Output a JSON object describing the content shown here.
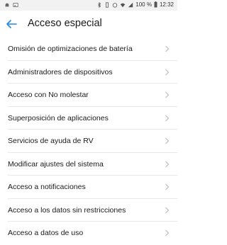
{
  "status_bar": {
    "battery": "100 %",
    "time": "12:32",
    "icons": [
      "android-icon",
      "image-icon",
      "bluetooth-icon",
      "vibrate-icon",
      "alarm-icon",
      "wifi-icon",
      "signal-icon",
      "battery-icon"
    ]
  },
  "app_bar": {
    "back_icon": "arrow-back-icon",
    "title": "Acceso especial"
  },
  "items": [
    {
      "label": "Omisión de optimizaciones de batería"
    },
    {
      "label": "Administradores de dispositivos"
    },
    {
      "label": "Acceso con No molestar"
    },
    {
      "label": "Superposición de aplicaciones"
    },
    {
      "label": "Servicios de ayuda de RV"
    },
    {
      "label": "Modificar ajustes del sistema"
    },
    {
      "label": "Acceso a notificaciones"
    },
    {
      "label": "Acceso a los datos sin restricciones"
    },
    {
      "label": "Acceso a datos de uso"
    }
  ],
  "colors": {
    "accent": "#1e88e5",
    "chevron": "#bdbdbd",
    "divider": "#e8e8e8"
  }
}
